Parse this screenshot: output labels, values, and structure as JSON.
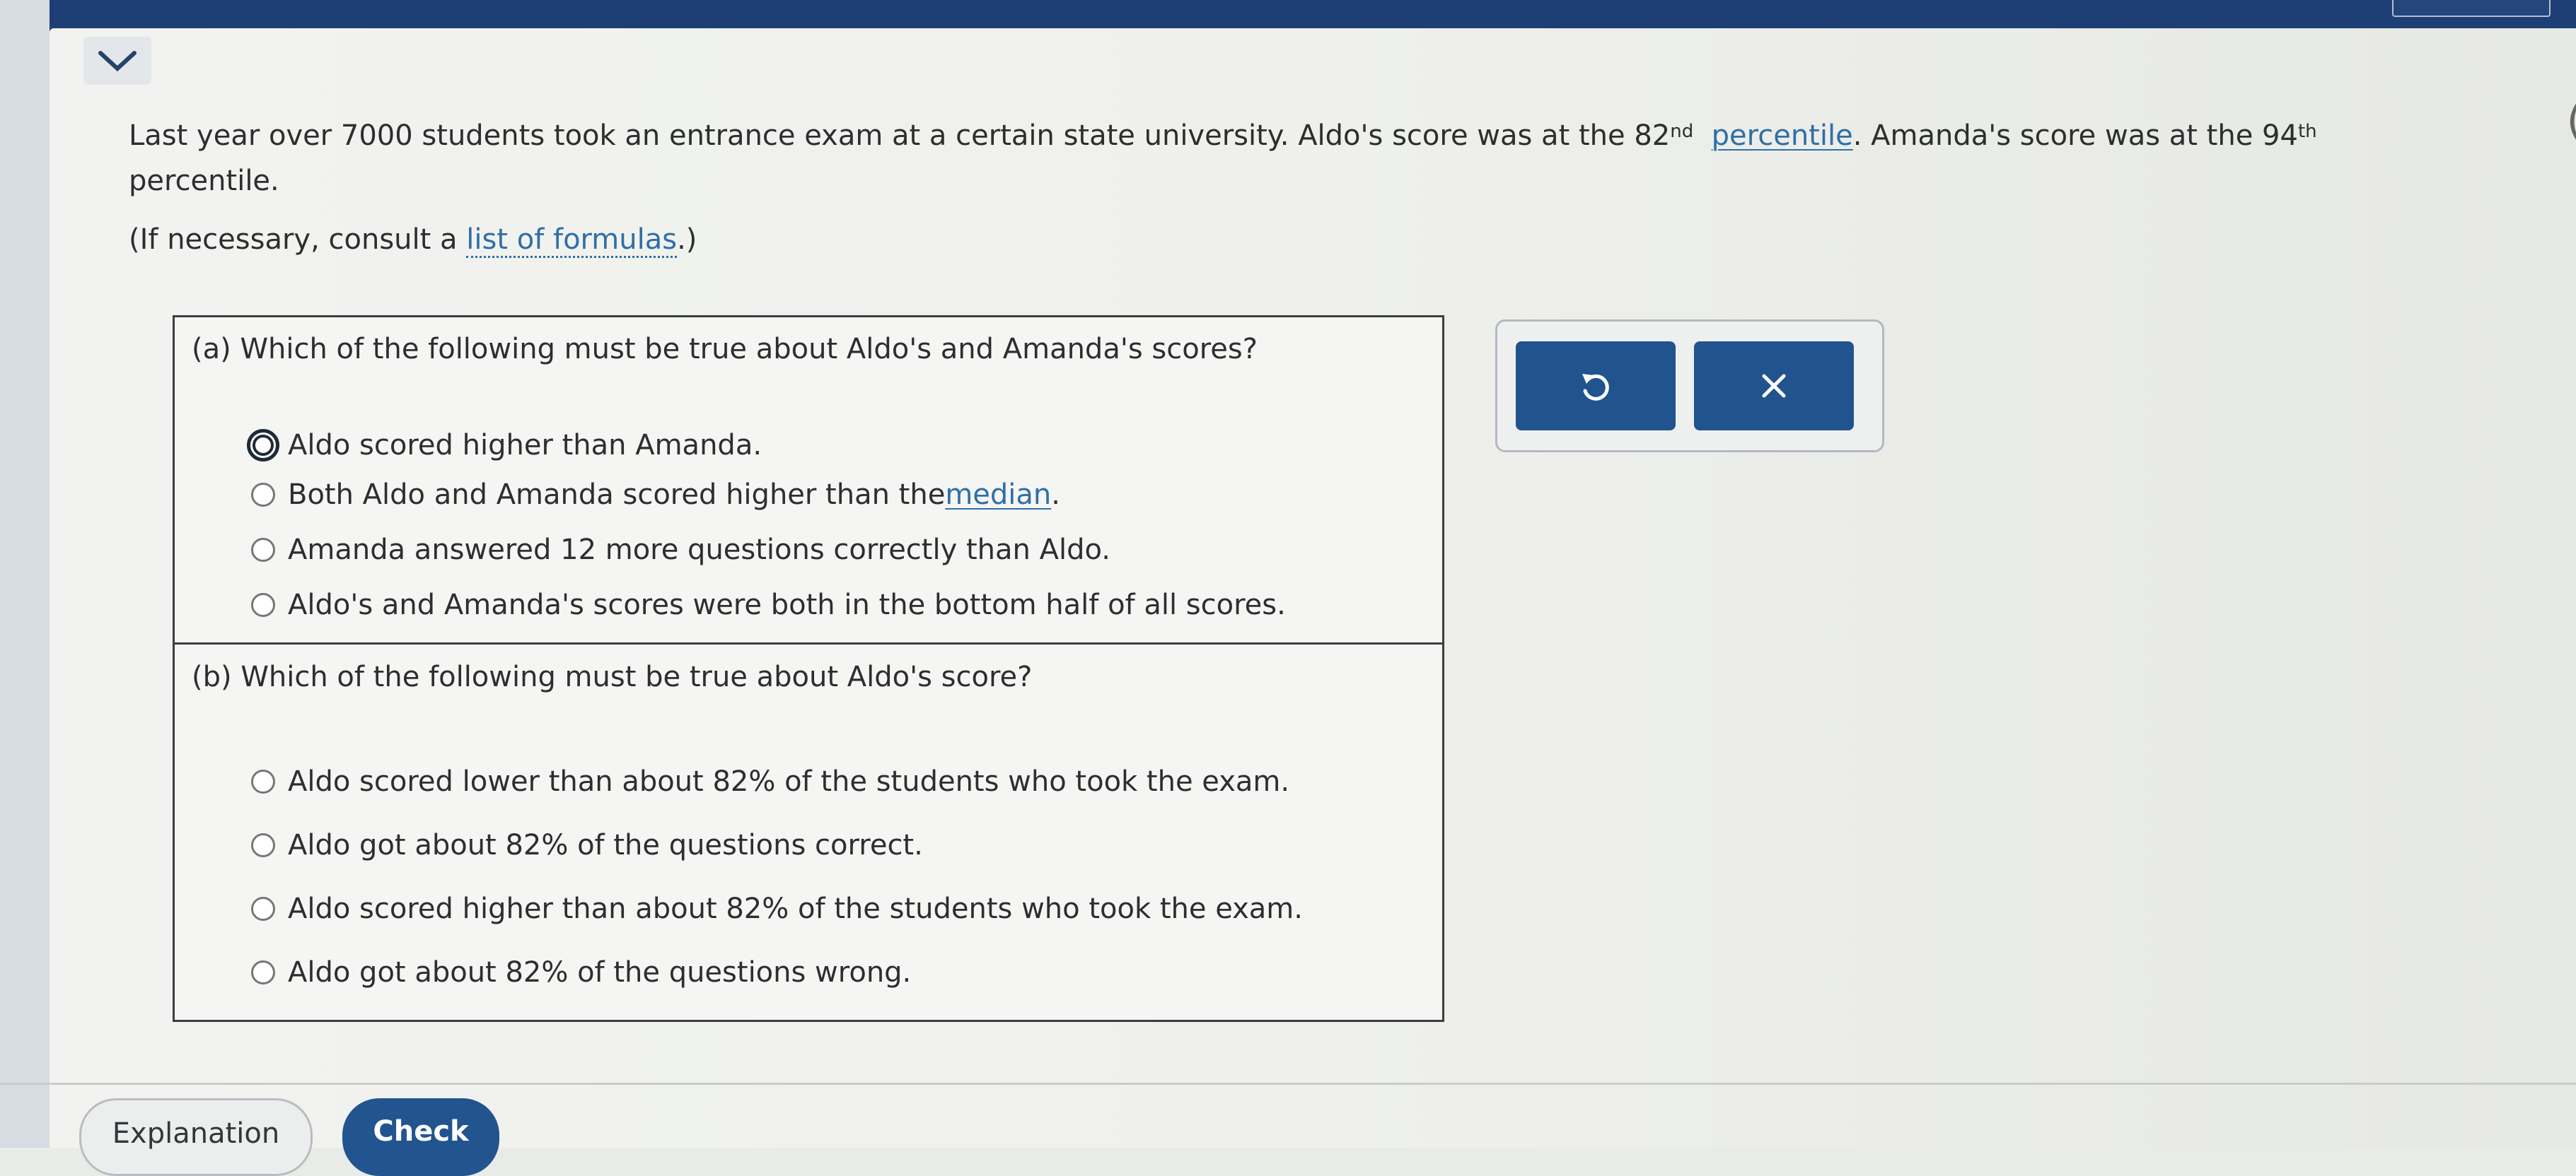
{
  "header": {
    "collapse_icon": "chevron-down-icon"
  },
  "stem": {
    "part1": "Last year over ",
    "num_students": "7000",
    "part2": " students took an entrance exam at a certain state university. Aldo's score was at the ",
    "aldo_pct": "82",
    "aldo_suffix": "nd",
    "percentile_link": "percentile",
    "part3": ". Amanda's score was at the ",
    "amanda_pct": "94",
    "amanda_suffix": "th",
    "part4": "percentile."
  },
  "hint": {
    "prefix": "(If necessary, consult a ",
    "link": "list of formulas",
    "suffix": ".)"
  },
  "question_a": {
    "title": "(a) Which of the following must be true about Aldo's and Amanda's scores?",
    "options": [
      {
        "label": "Aldo scored higher than Amanda."
      },
      {
        "label_prefix": "Both Aldo and Amanda scored higher than the ",
        "label_link": "median",
        "label_suffix": "."
      },
      {
        "label": "Amanda answered 12 more questions correctly than Aldo."
      },
      {
        "label": "Aldo's and Amanda's scores were both in the bottom half of all scores."
      }
    ]
  },
  "question_b": {
    "title": "(b) Which of the following must be true about Aldo's score?",
    "options": [
      {
        "label": "Aldo scored lower than about 82% of the students who took the exam."
      },
      {
        "label": "Aldo got about 82% of the questions correct."
      },
      {
        "label": "Aldo scored higher than about 82% of the students who took the exam."
      },
      {
        "label": "Aldo got about 82% of the questions wrong."
      }
    ]
  },
  "tools": {
    "undo_icon": "undo-icon",
    "clear_icon": "close-icon"
  },
  "footer": {
    "explanation_label": "Explanation",
    "check_label": "Check"
  },
  "colors": {
    "primary": "#225490",
    "link": "#2f6fa7",
    "header": "#1d3f75"
  }
}
